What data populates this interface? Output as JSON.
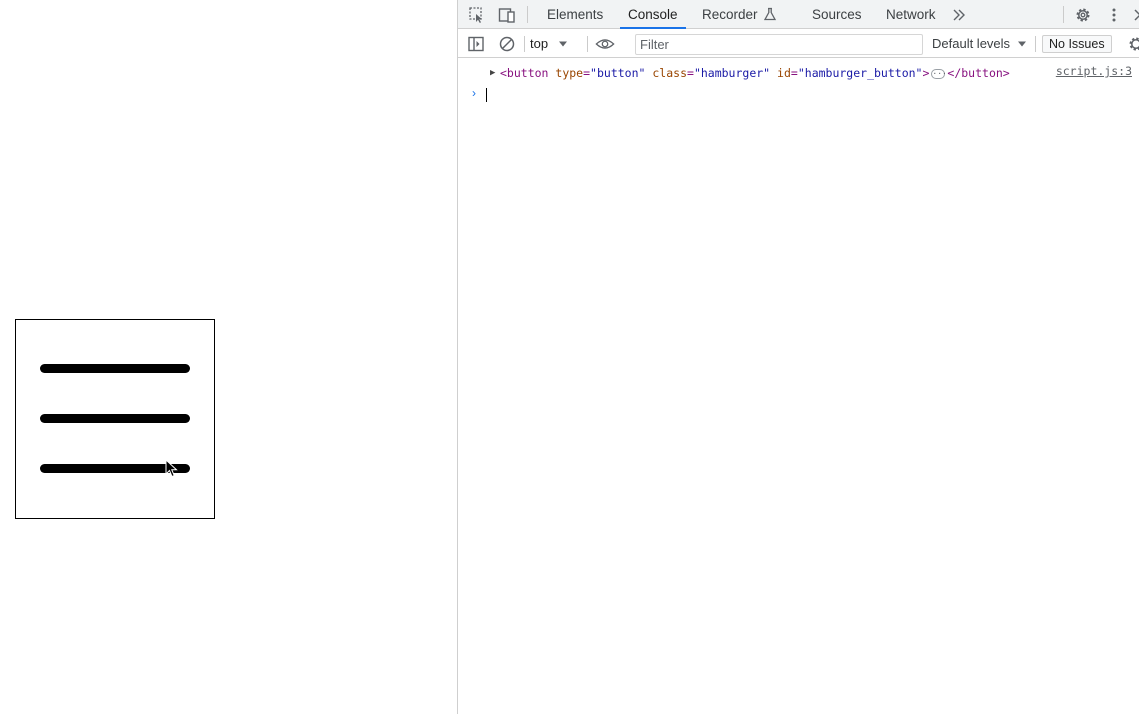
{
  "page": {
    "hamburger_button": {
      "type": "button",
      "class": "hamburger",
      "id": "hamburger_button"
    }
  },
  "devtools": {
    "tabs": [
      {
        "label": "Elements",
        "active": false
      },
      {
        "label": "Console",
        "active": true
      },
      {
        "label": "Recorder",
        "active": false
      },
      {
        "label": "Sources",
        "active": false
      },
      {
        "label": "Network",
        "active": false
      }
    ],
    "toolbar": {
      "context": "top",
      "filter_placeholder": "Filter",
      "levels": "Default levels",
      "issues": "No Issues"
    },
    "console": {
      "entries": [
        {
          "open_tag": "<button",
          "attrs": [
            {
              "name": "type",
              "value": "\"button\""
            },
            {
              "name": "class",
              "value": "\"hamburger\""
            },
            {
              "name": "id",
              "value": "\"hamburger_button\""
            }
          ],
          "close_open": ">",
          "close_tag": "</button>",
          "source": "script.js:3"
        }
      ]
    },
    "icons": [
      "inspect-element-icon",
      "device-toolbar-icon",
      "more-tabs-icon",
      "settings-icon",
      "kebab-menu-icon",
      "close-icon",
      "sidebar-toggle-icon",
      "clear-console-icon",
      "eye-icon",
      "console-settings-icon",
      "flask-icon"
    ],
    "accent_color": "#1a73e8"
  }
}
